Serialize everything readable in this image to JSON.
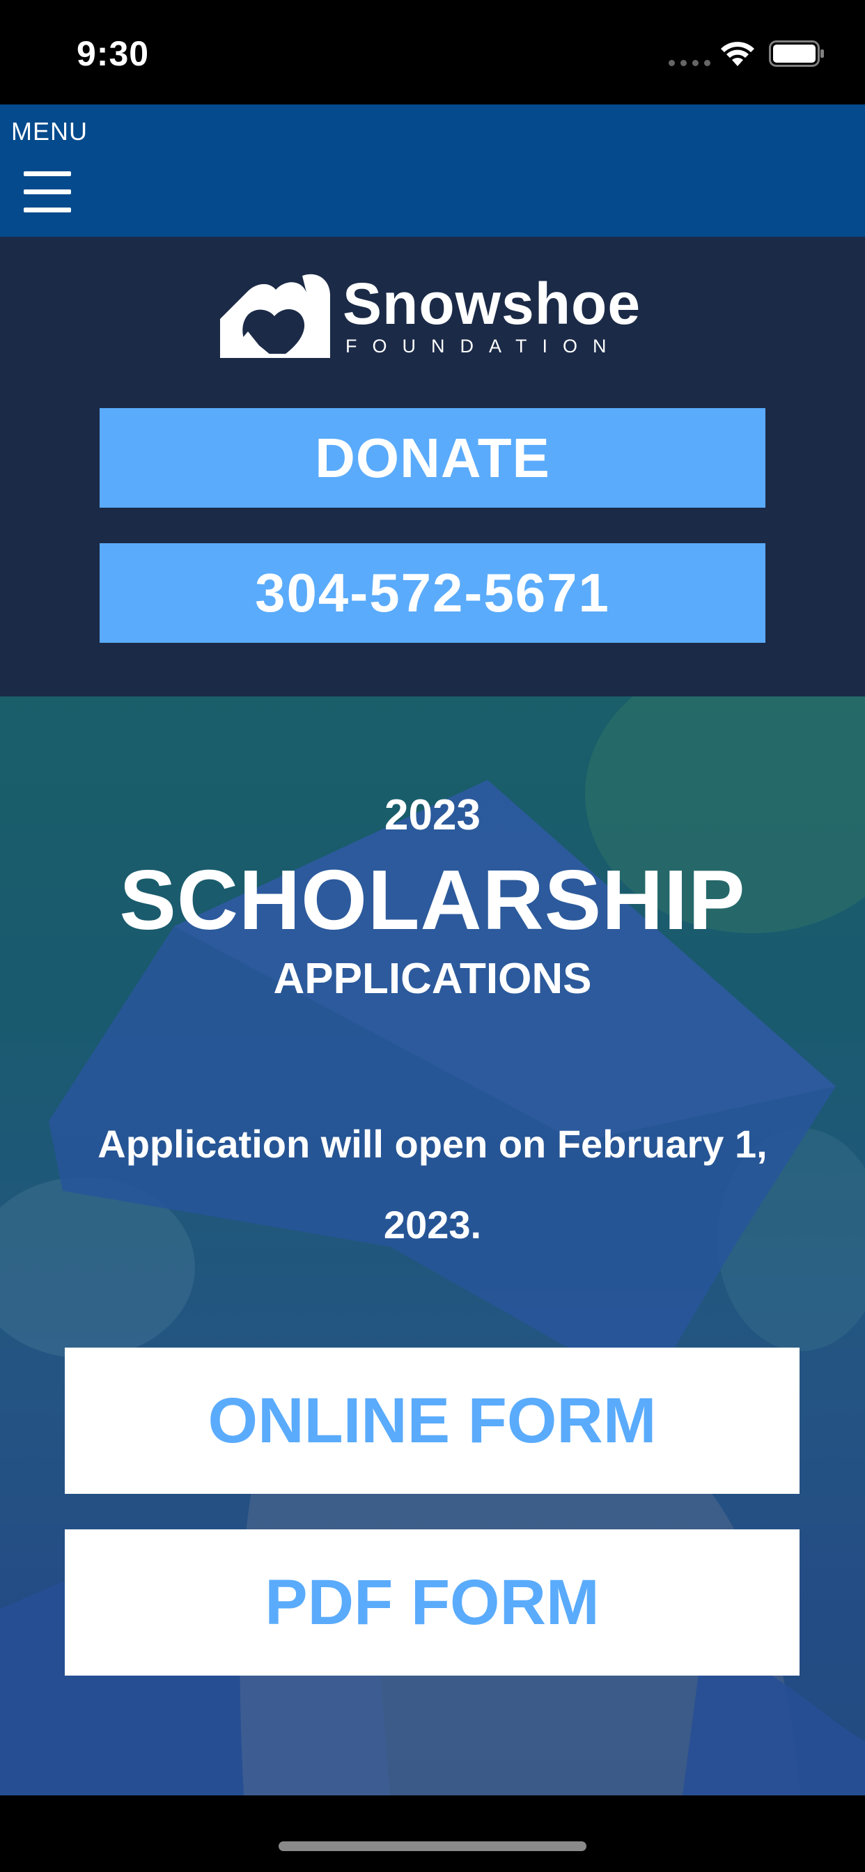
{
  "status_bar": {
    "time": "9:30"
  },
  "nav": {
    "menu_label": "MENU",
    "menu_icon": "hamburger-icon"
  },
  "logo": {
    "name": "Snowshoe",
    "subtitle": "FOUNDATION",
    "icon": "heart-logo-icon"
  },
  "actions": {
    "donate_label": "DONATE",
    "phone_label": "304-572-5671"
  },
  "hero": {
    "year": "2023",
    "title": "SCHOLARSHIP",
    "subtitle": "APPLICATIONS",
    "message": "Application will open on February 1, 2023.",
    "online_form_label": "ONLINE FORM",
    "pdf_form_label": "PDF FORM"
  },
  "colors": {
    "nav_bar": "#054a8c",
    "header_panel": "#1b2a47",
    "button_blue": "#5aabfb",
    "button_white": "#ffffff"
  }
}
